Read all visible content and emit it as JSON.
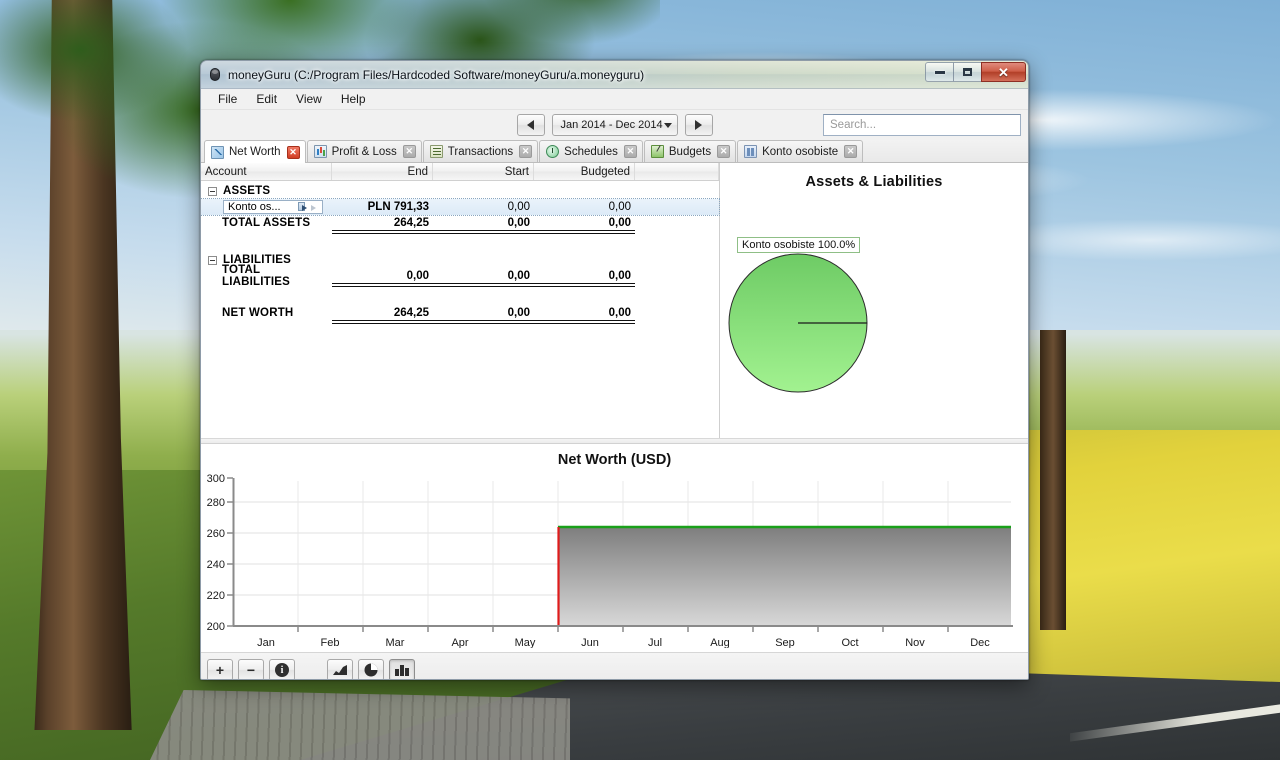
{
  "window": {
    "title": "moneyGuru (C:/Program Files/Hardcoded Software/moneyGuru/a.moneyguru)",
    "app_icon": "moneyguru-icon",
    "minimize_label": "–",
    "maximize_label": "□",
    "close_label": "✕"
  },
  "menu": {
    "items": [
      {
        "label": "File"
      },
      {
        "label": "Edit"
      },
      {
        "label": "View"
      },
      {
        "label": "Help"
      }
    ]
  },
  "toolbar": {
    "prev_label": "◀",
    "next_label": "▶",
    "date_range": "Jan 2014 - Dec 2014",
    "search_placeholder": "Search..."
  },
  "tabs": [
    {
      "label": "Net Worth",
      "icon": "networth-icon",
      "active": true,
      "close": "✕"
    },
    {
      "label": "Profit & Loss",
      "icon": "profitloss-icon",
      "active": false,
      "close": "✕"
    },
    {
      "label": "Transactions",
      "icon": "transactions-icon",
      "active": false,
      "close": "✕"
    },
    {
      "label": "Schedules",
      "icon": "schedules-icon",
      "active": false,
      "close": "✕"
    },
    {
      "label": "Budgets",
      "icon": "budgets-icon",
      "active": false,
      "close": "✕"
    },
    {
      "label": "Konto osobiste",
      "icon": "account-icon",
      "active": false,
      "close": "✕"
    }
  ],
  "accounts_table": {
    "columns": [
      "Account",
      "End",
      "Start",
      "Budgeted"
    ],
    "rows": [
      {
        "type": "group",
        "name": "ASSETS",
        "end": "",
        "start": "",
        "budgeted": ""
      },
      {
        "type": "account",
        "name": "Konto os...",
        "end": "PLN 791,33",
        "start": "0,00",
        "budgeted": "0,00",
        "selected": true,
        "editing": true
      },
      {
        "type": "total",
        "name": "TOTAL ASSETS",
        "end": "264,25",
        "start": "0,00",
        "budgeted": "0,00"
      },
      {
        "type": "spacer"
      },
      {
        "type": "group",
        "name": "LIABILITIES",
        "end": "",
        "start": "",
        "budgeted": ""
      },
      {
        "type": "total",
        "name": "TOTAL LIABILITIES",
        "end": "0,00",
        "start": "0,00",
        "budgeted": "0,00"
      },
      {
        "type": "spacer"
      },
      {
        "type": "total",
        "name": "NET WORTH",
        "end": "264,25",
        "start": "0,00",
        "budgeted": "0,00"
      }
    ]
  },
  "chart_data": [
    {
      "type": "pie",
      "title": "Assets & Liabilities",
      "labels": [
        "Konto osobiste"
      ],
      "values": [
        100.0
      ],
      "value_format": "percent",
      "annotations": [
        "Konto osobiste 100.0%"
      ],
      "colors": [
        "#7ed36f"
      ],
      "legend_position": "callout-top-left"
    },
    {
      "type": "area",
      "title": "Net Worth (USD)",
      "xlabel": "",
      "ylabel": "",
      "categories": [
        "Jan",
        "Feb",
        "Mar",
        "Apr",
        "May",
        "Jun",
        "Jul",
        "Aug",
        "Sep",
        "Oct",
        "Nov",
        "Dec"
      ],
      "ylim": [
        200,
        300
      ],
      "yticks": [
        200,
        220,
        240,
        260,
        280,
        300
      ],
      "grid": true,
      "series": [
        {
          "name": "Net Worth",
          "step_start_month": "Jun",
          "values": [
            null,
            null,
            null,
            null,
            null,
            264.25,
            264.25,
            264.25,
            264.25,
            264.25,
            264.25,
            264.25
          ]
        }
      ],
      "line_color": "#1aa01a",
      "marker_color": "#e01b1b",
      "fill_top_color": "#808080",
      "fill_bottom_color": "#d4d4d4"
    }
  ],
  "bottom_toolbar": {
    "buttons": [
      {
        "name": "add-account-button",
        "label": "+",
        "icon": "plus-icon",
        "pressed": false
      },
      {
        "name": "remove-account-button",
        "label": "−",
        "icon": "minus-icon",
        "pressed": false
      },
      {
        "name": "account-info-button",
        "label": "i",
        "icon": "info-icon",
        "pressed": false
      },
      {
        "name": "area-graph-button",
        "label": "",
        "icon": "area-chart-icon",
        "pressed": false
      },
      {
        "name": "pie-chart-button",
        "label": "",
        "icon": "pie-chart-icon",
        "pressed": false
      },
      {
        "name": "columns-button",
        "label": "",
        "icon": "columns-icon",
        "pressed": true
      }
    ]
  },
  "colors": {
    "pie_green_top": "#6ecb65",
    "pie_green_bottom": "#9ff08d",
    "graph_line_green": "#1aa01a",
    "graph_marker_red": "#e01b1b",
    "tab_active_close_red": "#d13c22",
    "window_close_red": "#b23f28"
  }
}
